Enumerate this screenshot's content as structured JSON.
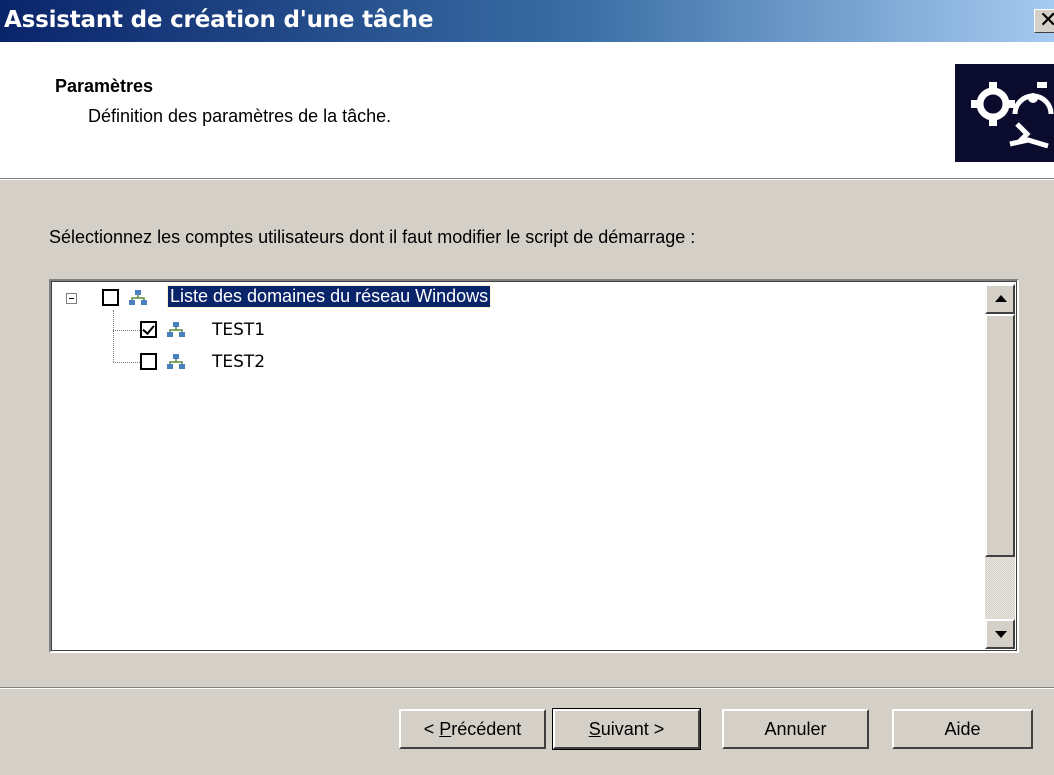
{
  "window": {
    "title": "Assistant de création d'une tâche",
    "close_glyph": "✕"
  },
  "header": {
    "title": "Paramètres",
    "subtitle": "Définition des paramètres de la tâche.",
    "icon": "gears-icon"
  },
  "main": {
    "instruction": "Sélectionnez les comptes utilisateurs dont il faut modifier le script de démarrage :"
  },
  "tree": {
    "root": {
      "label": "Liste des domaines du réseau Windows",
      "checked": false,
      "expanded": true,
      "icon": "network-icon"
    },
    "children": [
      {
        "label": "TEST1",
        "checked": true,
        "icon": "network-icon"
      },
      {
        "label": "TEST2",
        "checked": false,
        "icon": "network-icon"
      }
    ]
  },
  "buttons": {
    "back_prefix": "< ",
    "back_mnemonic": "P",
    "back_rest": "récédent",
    "next_mnemonic": "S",
    "next_rest": "uivant >",
    "cancel": "Annuler",
    "help": "Aide"
  },
  "colors": {
    "title_gradient_start": "#0a246a",
    "title_gradient_end": "#a6caf0",
    "selection": "#0a246a",
    "dialog_bg": "#d4d0c8"
  }
}
